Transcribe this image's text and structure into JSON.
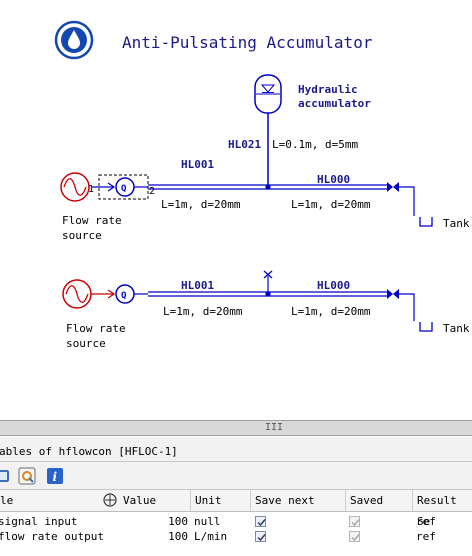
{
  "diagram": {
    "title": "Anti-Pulsating Accumulator",
    "accumulator_label_line1": "Hydraulic",
    "accumulator_label_line2": "accumulator",
    "hl021_label": "HL021",
    "hl021_params": "L=0.1m, d=5mm",
    "top": {
      "hl001_label": "HL001",
      "hl001_params": "L=1m, d=20mm",
      "hl000_label": "HL000",
      "hl000_params": "L=1m, d=20mm",
      "source_line1": "Flow rate",
      "source_line2": "source",
      "tank_label": "Tank",
      "port1": "1",
      "port2": "2",
      "q_symbol": "Q"
    },
    "bottom": {
      "hl001_label": "HL001",
      "hl001_params": "L=1m, d=20mm",
      "hl000_label": "HL000",
      "hl000_params": "L=1m, d=20mm",
      "source_line1": "Flow rate",
      "source_line2": "source",
      "tank_label": "Tank"
    }
  },
  "splitter": {
    "grip": "III"
  },
  "panel": {
    "title": "ables of hflowcon [HFLOC-1]"
  },
  "grid": {
    "columns": [
      "le",
      "Value",
      "Unit",
      "Save next",
      "Saved",
      "Result Se"
    ],
    "rows": [
      {
        "name": "signal input",
        "value": "100",
        "unit": "null",
        "save_next": true,
        "saved": true,
        "result": "ref"
      },
      {
        "name": "flow rate output",
        "value": "100",
        "unit": "L/min",
        "save_next": true,
        "saved": true,
        "result": "ref"
      }
    ]
  },
  "colors": {
    "pipe": "#0000c8",
    "title": "#1a1a8c",
    "source": "#c80000"
  }
}
